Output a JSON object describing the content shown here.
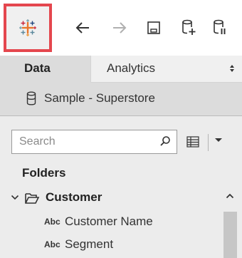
{
  "toolbar": {
    "logo_icon": "tableau-logo-icon",
    "buttons": [
      "back-arrow-icon",
      "forward-arrow-icon",
      "save-icon",
      "new-data-source-icon",
      "pause-auto-updates-icon"
    ],
    "highlight_color": "#e4474e"
  },
  "tabs": {
    "data_label": "Data",
    "analytics_label": "Analytics"
  },
  "datasource": {
    "icon": "database-cylinder-icon",
    "name": "Sample - Superstore"
  },
  "search": {
    "placeholder": "Search"
  },
  "folders": {
    "heading": "Folders",
    "folder": {
      "name": "Customer",
      "expanded": true,
      "fields": [
        {
          "type_label": "Abc",
          "name": "Customer Name"
        },
        {
          "type_label": "Abc",
          "name": "Segment"
        }
      ]
    }
  }
}
